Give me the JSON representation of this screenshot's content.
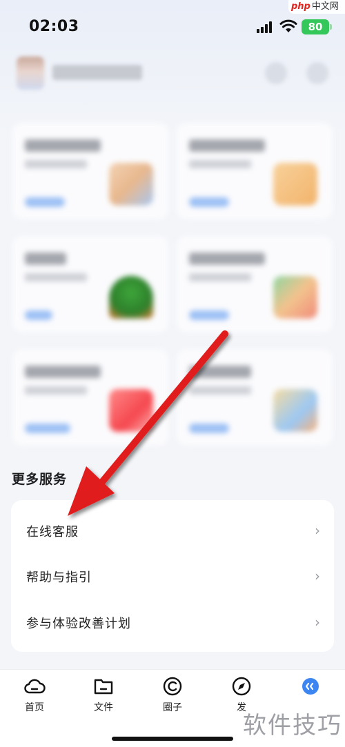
{
  "status_bar": {
    "time": "02:03",
    "battery": "80"
  },
  "watermark_top": {
    "brand": "php",
    "text": "中文网"
  },
  "more_services": {
    "title": "更多服务",
    "items": [
      {
        "label": "在线客服"
      },
      {
        "label": "帮助与指引"
      },
      {
        "label": "参与体验改善计划"
      }
    ]
  },
  "tab_bar": {
    "tabs": [
      {
        "label": "首页",
        "icon": "cloud-icon"
      },
      {
        "label": "文件",
        "icon": "folder-icon"
      },
      {
        "label": "圈子",
        "icon": "circle-c-icon"
      },
      {
        "label": "发",
        "icon": "compass-icon"
      },
      {
        "label": "",
        "icon": "profile-badge-icon"
      }
    ]
  },
  "watermark_bottom": "软件技巧",
  "colors": {
    "arrow": "#e11d1d",
    "battery": "#34c759",
    "accent": "#3d86f2"
  }
}
